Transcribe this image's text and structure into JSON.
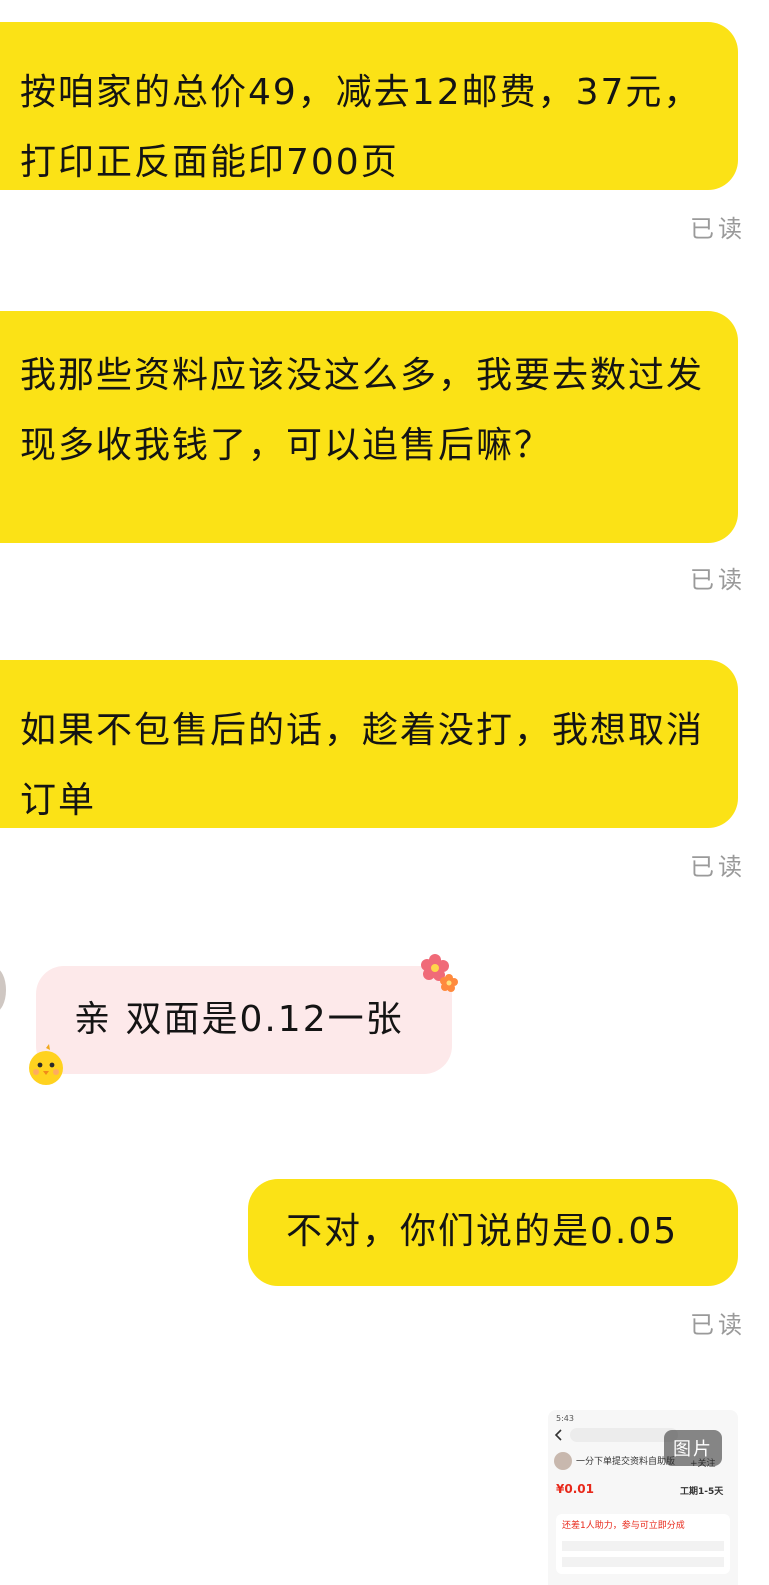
{
  "messages": [
    {
      "id": "m1",
      "text": "按咱家的总价49，减去12邮费，37元，打印正反面能印700页",
      "status": "已读"
    },
    {
      "id": "m2",
      "text": "我那些资料应该没这么多，我要去数过发现多收我钱了，可以追售后嘛？",
      "status": "已读"
    },
    {
      "id": "m3",
      "text": "如果不包售后的话，趁着没打，我想取消订单",
      "status": "已读"
    },
    {
      "id": "m4",
      "text": "亲 双面是0.12一张"
    },
    {
      "id": "m5",
      "text": "不对，你们说的是0.05",
      "status": "已读"
    }
  ],
  "image_message": {
    "badge": "图片",
    "status_time": "5:43",
    "product_title": "一分下单提交资料自助版",
    "price": "¥0.01",
    "delivery": "工期1-5天",
    "follow": "+关注",
    "promo": "还差1人助力，参与可立即分成"
  },
  "colors": {
    "sent_bubble": "#fbe216",
    "received_bubble": "#fde9ea",
    "read_status": "#9a9a9a"
  },
  "icons": {
    "received_decoration_left": "chick-icon",
    "received_decoration_right": "flower-icon",
    "back": "chevron-left-icon"
  }
}
